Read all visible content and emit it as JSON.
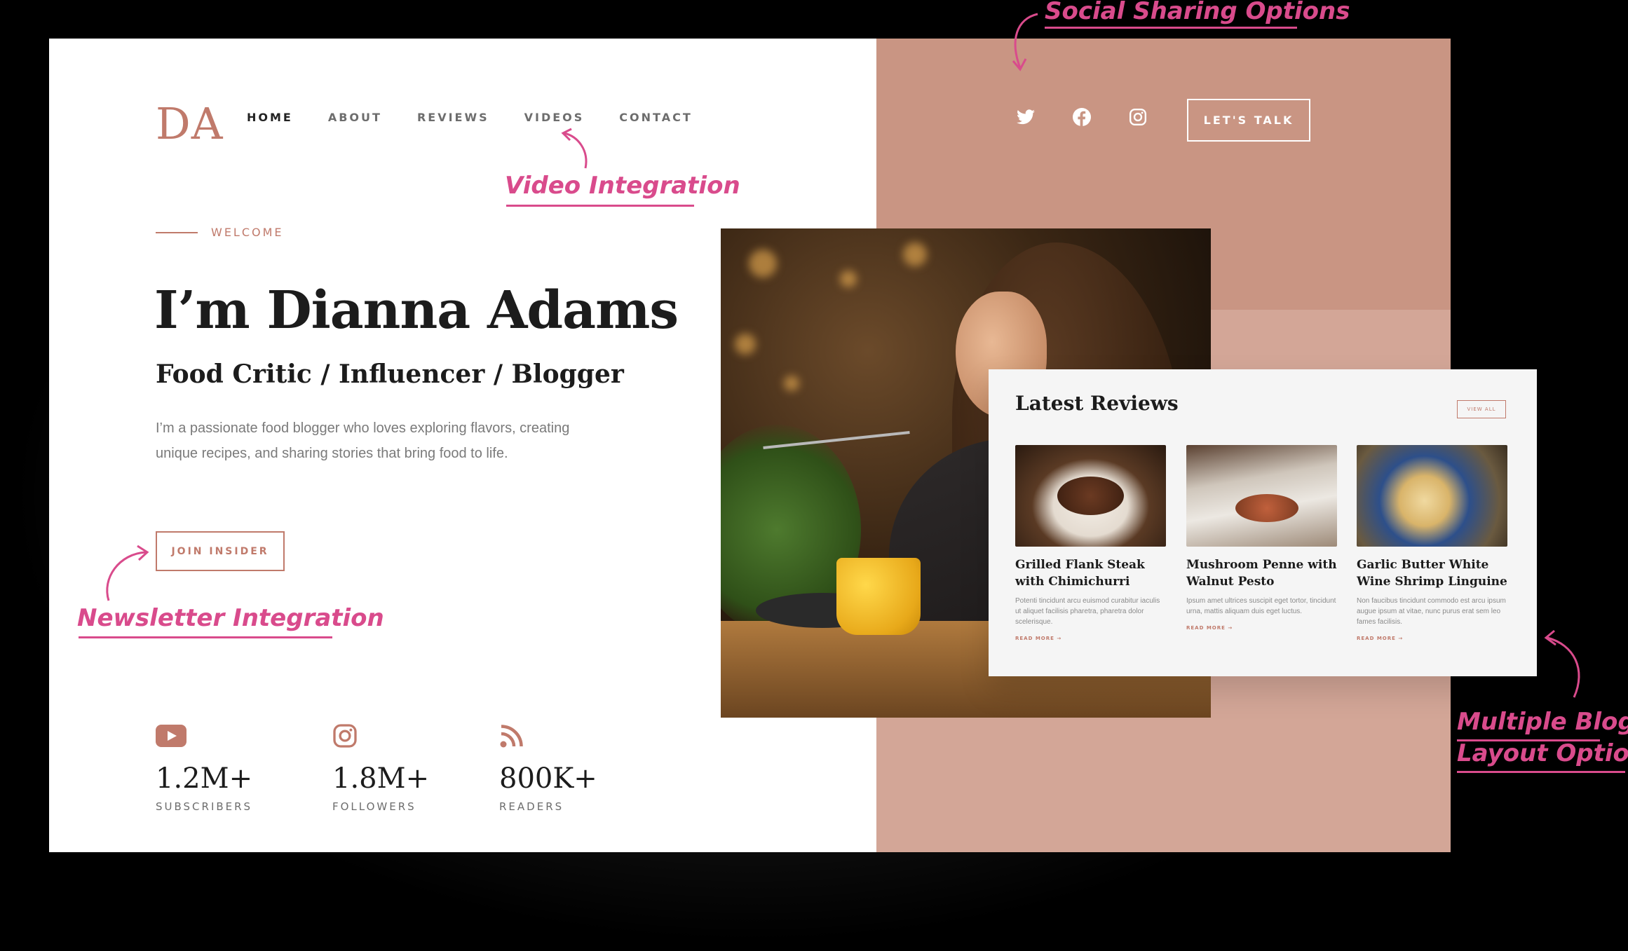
{
  "header": {
    "logo": "DA",
    "nav": [
      {
        "label": "HOME",
        "active": true
      },
      {
        "label": "ABOUT",
        "active": false
      },
      {
        "label": "REVIEWS",
        "active": false
      },
      {
        "label": "VIDEOS",
        "active": false
      },
      {
        "label": "CONTACT",
        "active": false
      }
    ],
    "socials": [
      "twitter-icon",
      "facebook-icon",
      "instagram-icon"
    ],
    "cta_label": "LET'S TALK"
  },
  "hero": {
    "eyebrow": "WELCOME",
    "title": "I’m Dianna Adams",
    "subtitle": "Food Critic / Influencer / Blogger",
    "description": "I’m a passionate food blogger who loves exploring flavors, creating unique recipes, and sharing stories that bring food to life.",
    "button_label": "JOIN INSIDER"
  },
  "stats": [
    {
      "icon": "youtube-icon",
      "value": "1.2M+",
      "label": "SUBSCRIBERS"
    },
    {
      "icon": "instagram-icon",
      "value": "1.8M+",
      "label": "FOLLOWERS"
    },
    {
      "icon": "rss-icon",
      "value": "800K+",
      "label": "READERS"
    }
  ],
  "reviews": {
    "title": "Latest Reviews",
    "view_all": "VIEW ALL",
    "items": [
      {
        "title": "Grilled Flank Steak with Chimichurri",
        "excerpt": "Potenti tincidunt arcu euismod curabitur iaculis ut aliquet facilisis pharetra, pharetra dolor scelerisque.",
        "more": "READ MORE →"
      },
      {
        "title": "Mushroom Penne with Walnut Pesto",
        "excerpt": "Ipsum amet ultrices suscipit eget tortor, tincidunt urna, mattis aliquam duis eget luctus.",
        "more": "READ MORE →"
      },
      {
        "title": "Garlic Butter White Wine Shrimp Linguine",
        "excerpt": "Non faucibus tincidunt commodo est arcu ipsum augue ipsum at vitae, nunc purus erat sem leo fames facilisis.",
        "more": "READ MORE →"
      }
    ]
  },
  "annotations": {
    "social": "Social Sharing Options",
    "video": "Video Integration",
    "newsletter": "Newsletter Integration",
    "blog_line1": "Multiple Blog",
    "blog_line2": "Layout Options"
  },
  "colors": {
    "accent": "#c07a6b",
    "panel": "#d3a697",
    "annotation": "#d94b8c"
  }
}
